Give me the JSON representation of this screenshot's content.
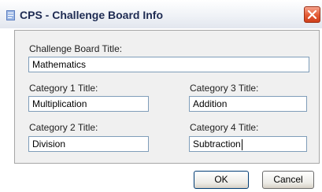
{
  "window": {
    "title": "CPS - Challenge Board Info"
  },
  "form": {
    "board_title_label": "Challenge Board Title:",
    "board_title_value": "Mathematics",
    "category1_label": "Category 1 Title:",
    "category1_value": "Multiplication",
    "category2_label": "Category 2 Title:",
    "category2_value": "Division",
    "category3_label": "Category 3 Title:",
    "category3_value": "Addition",
    "category4_label": "Category 4 Title:",
    "category4_value": "Subtraction"
  },
  "buttons": {
    "ok_label": "OK",
    "cancel_label": "Cancel"
  },
  "icons": {
    "app": "app-icon",
    "close": "close-icon"
  },
  "colors": {
    "close_button": "#e35a34",
    "title_text": "#1e2b52",
    "field_border": "#7f9db9"
  }
}
